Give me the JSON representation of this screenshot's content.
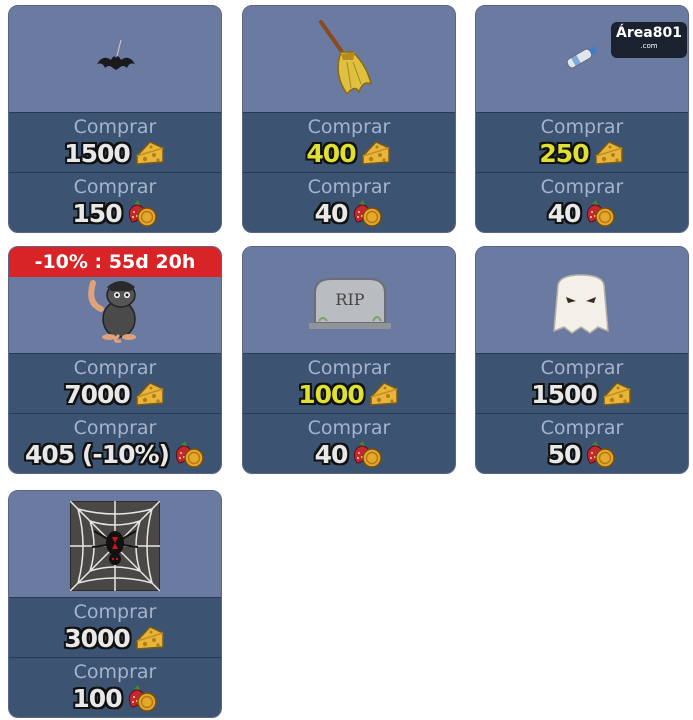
{
  "watermark": {
    "text": "Área801",
    "sub": ".com"
  },
  "buy_label": "Comprar",
  "cards": [
    {
      "item": "bat",
      "cheese_price": "1500",
      "cheese_gold": false,
      "berry_price": "150"
    },
    {
      "item": "broom",
      "cheese_price": "400",
      "cheese_gold": true,
      "berry_price": "40"
    },
    {
      "item": "bottle",
      "cheese_price": "250",
      "cheese_gold": true,
      "berry_price": "40"
    },
    {
      "item": "mouse-costume",
      "promo": "-10% : 55d 20h",
      "cheese_price": "7000",
      "cheese_gold": false,
      "berry_price": "405 (-10%)"
    },
    {
      "item": "tombstone",
      "tomb_text": "RIP",
      "cheese_price": "1000",
      "cheese_gold": true,
      "berry_price": "40"
    },
    {
      "item": "ghost",
      "cheese_price": "1500",
      "cheese_gold": false,
      "berry_price": "50"
    },
    {
      "item": "spider-web",
      "cheese_price": "3000",
      "cheese_gold": false,
      "berry_price": "100"
    }
  ],
  "colors": {
    "card_bg": "#6b7aa1",
    "row_bg": "#3c5472",
    "gold_price": "#dfe030",
    "promo": "#d82426"
  }
}
